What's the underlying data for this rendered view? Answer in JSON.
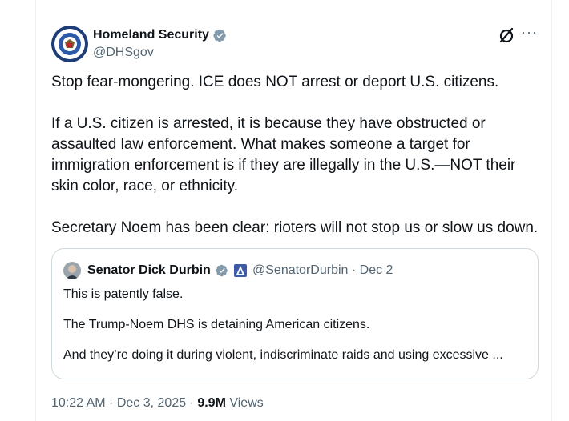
{
  "author": {
    "name": "Homeland Security",
    "handle": "@DHSgov"
  },
  "tweet": {
    "text": "Stop fear-mongering. ICE does NOT arrest or deport U.S. citizens.\n\nIf a U.S. citizen is arrested, it is because they have obstructed or assaulted law enforcement. What makes someone a target for immigration enforcement is if they are illegally in the U.S.—NOT their skin color, race, or ethnicity.\n\nSecretary Noem has been clear: rioters will not stop us or slow us down."
  },
  "quote": {
    "name": "Senator Dick Durbin",
    "handle_date": "@SenatorDurbin · Dec 2",
    "lines": [
      "This is patently false.",
      "The Trump-Noem DHS is detaining American citizens.",
      "And they’re doing it during violent, indiscriminate raids and using excessive ..."
    ]
  },
  "meta": {
    "time": "10:22 AM",
    "sep1": " · ",
    "date": "Dec 3, 2025",
    "sep2": " · ",
    "views_count": "9.9M",
    "views_label": " Views"
  },
  "icons": {
    "verified": "verified-badge-icon",
    "grok": "grok-icon",
    "more": "more-dots-icon",
    "government_flag": "government-label-icon"
  },
  "colors": {
    "text": "#0f1419",
    "secondary": "#536471",
    "verified_gray": "#829aab",
    "border": "#cfd9de"
  }
}
